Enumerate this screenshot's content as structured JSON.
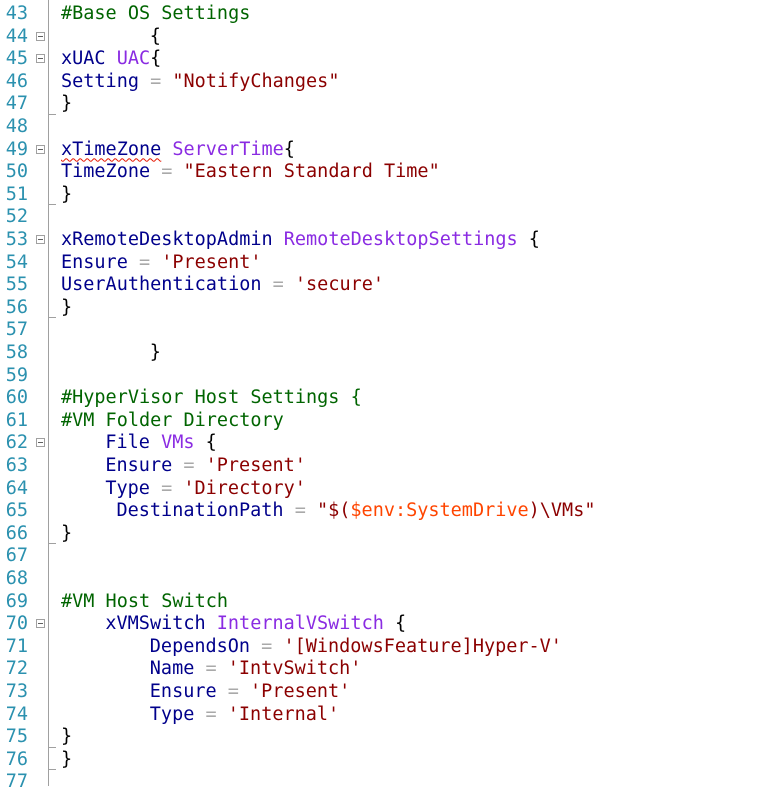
{
  "colors": {
    "line_number": "#2b91af",
    "comment": "#006400",
    "keyword": "#00008b",
    "type_name": "#8a2be2",
    "string": "#8b0000",
    "variable": "#ff4500",
    "operator": "#a9a9a9",
    "plain": "#000000",
    "error_squiggle": "#e51400"
  },
  "lines": [
    {
      "num": "43",
      "fold": false,
      "indent": 0,
      "tokens": [
        {
          "t": "#Base OS Settings",
          "c": "comment"
        }
      ]
    },
    {
      "num": "44",
      "fold": true,
      "indent": 8,
      "tokens": [
        {
          "t": "{",
          "c": "plain"
        }
      ]
    },
    {
      "num": "45",
      "fold": true,
      "indent": 0,
      "tokens": [
        {
          "t": "xUAC",
          "c": "keyword"
        },
        {
          "t": " ",
          "c": "plain"
        },
        {
          "t": "UAC",
          "c": "type_name"
        },
        {
          "t": "{",
          "c": "plain"
        }
      ]
    },
    {
      "num": "46",
      "fold": false,
      "indent": 0,
      "tokens": [
        {
          "t": "Setting",
          "c": "keyword"
        },
        {
          "t": " = ",
          "c": "operator"
        },
        {
          "t": "\"NotifyChanges\"",
          "c": "string"
        }
      ]
    },
    {
      "num": "47",
      "fold": false,
      "indent": 0,
      "tokens": [
        {
          "t": "}",
          "c": "plain"
        }
      ]
    },
    {
      "num": "48",
      "fold": false,
      "indent": 0,
      "tokens": []
    },
    {
      "num": "49",
      "fold": true,
      "indent": 0,
      "tokens": [
        {
          "t": "xTimeZone",
          "c": "keyword",
          "squiggle": true
        },
        {
          "t": " ",
          "c": "plain"
        },
        {
          "t": "ServerTime",
          "c": "type_name"
        },
        {
          "t": "{",
          "c": "plain"
        }
      ]
    },
    {
      "num": "50",
      "fold": false,
      "indent": 0,
      "tokens": [
        {
          "t": "TimeZone",
          "c": "keyword"
        },
        {
          "t": " = ",
          "c": "operator"
        },
        {
          "t": "\"Eastern Standard Time\"",
          "c": "string"
        }
      ]
    },
    {
      "num": "51",
      "fold": false,
      "indent": 0,
      "tokens": [
        {
          "t": "}",
          "c": "plain"
        }
      ]
    },
    {
      "num": "52",
      "fold": false,
      "indent": 0,
      "tokens": []
    },
    {
      "num": "53",
      "fold": true,
      "indent": 0,
      "tokens": [
        {
          "t": "xRemoteDesktopAdmin",
          "c": "keyword"
        },
        {
          "t": " ",
          "c": "plain"
        },
        {
          "t": "RemoteDesktopSettings",
          "c": "type_name"
        },
        {
          "t": " {",
          "c": "plain"
        }
      ]
    },
    {
      "num": "54",
      "fold": false,
      "indent": 0,
      "tokens": [
        {
          "t": "Ensure",
          "c": "keyword"
        },
        {
          "t": " = ",
          "c": "operator"
        },
        {
          "t": "'Present'",
          "c": "string"
        }
      ]
    },
    {
      "num": "55",
      "fold": false,
      "indent": 0,
      "tokens": [
        {
          "t": "UserAuthentication",
          "c": "keyword"
        },
        {
          "t": " = ",
          "c": "operator"
        },
        {
          "t": "'secure'",
          "c": "string"
        }
      ]
    },
    {
      "num": "56",
      "fold": false,
      "indent": 0,
      "tokens": [
        {
          "t": "}",
          "c": "plain"
        }
      ]
    },
    {
      "num": "57",
      "fold": false,
      "indent": 0,
      "tokens": []
    },
    {
      "num": "58",
      "fold": false,
      "indent": 8,
      "tokens": [
        {
          "t": "}",
          "c": "plain"
        }
      ]
    },
    {
      "num": "59",
      "fold": false,
      "indent": 0,
      "tokens": []
    },
    {
      "num": "60",
      "fold": false,
      "indent": 0,
      "tokens": [
        {
          "t": "#HyperVisor Host Settings {",
          "c": "comment"
        }
      ]
    },
    {
      "num": "61",
      "fold": false,
      "indent": 0,
      "tokens": [
        {
          "t": "#VM Folder Directory",
          "c": "comment"
        }
      ]
    },
    {
      "num": "62",
      "fold": true,
      "indent": 4,
      "tokens": [
        {
          "t": "File",
          "c": "keyword"
        },
        {
          "t": " ",
          "c": "plain"
        },
        {
          "t": "VMs",
          "c": "type_name"
        },
        {
          "t": " {",
          "c": "plain"
        }
      ]
    },
    {
      "num": "63",
      "fold": false,
      "indent": 4,
      "tokens": [
        {
          "t": "Ensure",
          "c": "keyword"
        },
        {
          "t": " = ",
          "c": "operator"
        },
        {
          "t": "'Present'",
          "c": "string"
        }
      ]
    },
    {
      "num": "64",
      "fold": false,
      "indent": 4,
      "tokens": [
        {
          "t": "Type",
          "c": "keyword"
        },
        {
          "t": " = ",
          "c": "operator"
        },
        {
          "t": "'Directory'",
          "c": "string"
        }
      ]
    },
    {
      "num": "65",
      "fold": false,
      "indent": 5,
      "tokens": [
        {
          "t": "DestinationPath",
          "c": "keyword"
        },
        {
          "t": " = ",
          "c": "operator"
        },
        {
          "t": "\"$(",
          "c": "string"
        },
        {
          "t": "$env:SystemDrive",
          "c": "variable"
        },
        {
          "t": ")\\VMs\"",
          "c": "string"
        }
      ]
    },
    {
      "num": "66",
      "fold": false,
      "indent": 0,
      "tokens": [
        {
          "t": "}",
          "c": "plain"
        }
      ]
    },
    {
      "num": "67",
      "fold": false,
      "indent": 0,
      "tokens": []
    },
    {
      "num": "68",
      "fold": false,
      "indent": 0,
      "tokens": []
    },
    {
      "num": "69",
      "fold": false,
      "indent": 0,
      "tokens": [
        {
          "t": "#VM Host Switch",
          "c": "comment"
        }
      ]
    },
    {
      "num": "70",
      "fold": true,
      "indent": 4,
      "tokens": [
        {
          "t": "xVMSwitch",
          "c": "keyword"
        },
        {
          "t": " ",
          "c": "plain"
        },
        {
          "t": "InternalVSwitch",
          "c": "type_name"
        },
        {
          "t": " {",
          "c": "plain"
        }
      ]
    },
    {
      "num": "71",
      "fold": false,
      "indent": 8,
      "tokens": [
        {
          "t": "DependsOn",
          "c": "keyword"
        },
        {
          "t": " = ",
          "c": "operator"
        },
        {
          "t": "'[WindowsFeature]Hyper-V'",
          "c": "string"
        }
      ]
    },
    {
      "num": "72",
      "fold": false,
      "indent": 8,
      "tokens": [
        {
          "t": "Name",
          "c": "keyword"
        },
        {
          "t": " = ",
          "c": "operator"
        },
        {
          "t": "'IntvSwitch'",
          "c": "string"
        }
      ]
    },
    {
      "num": "73",
      "fold": false,
      "indent": 8,
      "tokens": [
        {
          "t": "Ensure",
          "c": "keyword"
        },
        {
          "t": " = ",
          "c": "operator"
        },
        {
          "t": "'Present'",
          "c": "string"
        }
      ]
    },
    {
      "num": "74",
      "fold": false,
      "indent": 8,
      "tokens": [
        {
          "t": "Type",
          "c": "keyword"
        },
        {
          "t": " = ",
          "c": "operator"
        },
        {
          "t": "'Internal'",
          "c": "string"
        }
      ]
    },
    {
      "num": "75",
      "fold": false,
      "indent": 0,
      "tokens": [
        {
          "t": "}",
          "c": "plain"
        }
      ]
    },
    {
      "num": "76",
      "fold": false,
      "indent": 0,
      "tokens": [
        {
          "t": "}",
          "c": "plain"
        }
      ]
    },
    {
      "num": "77",
      "fold": false,
      "indent": 0,
      "tokens": []
    }
  ]
}
